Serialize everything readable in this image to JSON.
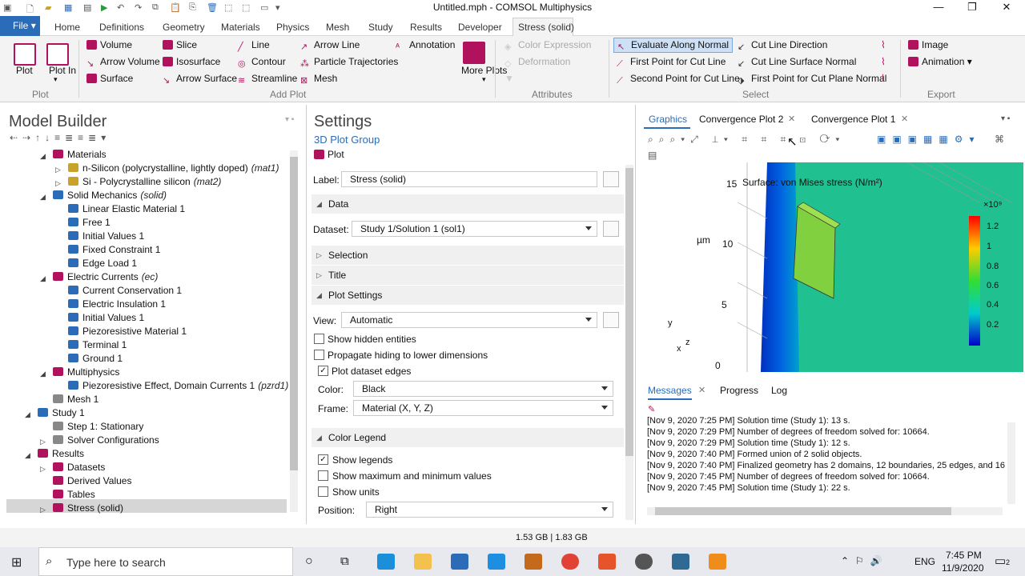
{
  "window": {
    "title": "Untitled.mph - COMSOL Multiphysics",
    "min": "—",
    "max": "❐",
    "close": "✕"
  },
  "menu": {
    "file": "File",
    "tabs": [
      "Home",
      "Definitions",
      "Geometry",
      "Materials",
      "Physics",
      "Mesh",
      "Study",
      "Results",
      "Developer",
      "Stress (solid)"
    ]
  },
  "ribbon": {
    "plot": "Plot",
    "plot_in": "Plot In",
    "plot_in_arrow": "▾",
    "group_plot": "Plot",
    "add": [
      "Volume",
      "Arrow Volume",
      "Surface",
      "Slice",
      "Isosurface",
      "Arrow Surface",
      "Line",
      "Contour",
      "Streamline",
      "Arrow Line",
      "Particle Trajectories",
      "Mesh",
      "Annotation"
    ],
    "more_plots": "More Plots",
    "more_plots_arrow": "▾",
    "group_addplot": "Add Plot",
    "attributes": [
      "Color Expression",
      "Deformation"
    ],
    "group_attributes": "Attributes",
    "select": [
      "Evaluate Along Normal",
      "First Point for Cut Line",
      "Second Point for Cut Line",
      "Cut Line Direction",
      "Cut Line Surface Normal",
      "First Point for Cut Plane Normal"
    ],
    "group_select": "Select",
    "export": [
      "Image",
      "Animation"
    ],
    "export_arrow": "▾",
    "group_export": "Export"
  },
  "model_builder": {
    "title": "Model Builder",
    "items": [
      {
        "t": "Materials",
        "s": ""
      },
      {
        "t": "n-Silicon (polycrystalline, lightly doped)",
        "s": "(mat1)"
      },
      {
        "t": "Si - Polycrystalline silicon",
        "s": "(mat2)"
      },
      {
        "t": "Solid Mechanics",
        "s": "(solid)"
      },
      {
        "t": "Linear Elastic Material 1",
        "s": ""
      },
      {
        "t": "Free 1",
        "s": ""
      },
      {
        "t": "Initial Values 1",
        "s": ""
      },
      {
        "t": "Fixed Constraint 1",
        "s": ""
      },
      {
        "t": "Edge Load 1",
        "s": ""
      },
      {
        "t": "Electric Currents",
        "s": "(ec)"
      },
      {
        "t": "Current Conservation 1",
        "s": ""
      },
      {
        "t": "Electric Insulation 1",
        "s": ""
      },
      {
        "t": "Initial Values 1",
        "s": ""
      },
      {
        "t": "Piezoresistive Material 1",
        "s": ""
      },
      {
        "t": "Terminal 1",
        "s": ""
      },
      {
        "t": "Ground 1",
        "s": ""
      },
      {
        "t": "Multiphysics",
        "s": ""
      },
      {
        "t": "Piezoresistive Effect, Domain Currents 1",
        "s": "(pzrd1)"
      },
      {
        "t": "Mesh 1",
        "s": ""
      },
      {
        "t": "Study 1",
        "s": ""
      },
      {
        "t": "Step 1: Stationary",
        "s": ""
      },
      {
        "t": "Solver Configurations",
        "s": ""
      },
      {
        "t": "Results",
        "s": ""
      },
      {
        "t": "Datasets",
        "s": ""
      },
      {
        "t": "Derived Values",
        "s": ""
      },
      {
        "t": "Tables",
        "s": ""
      },
      {
        "t": "Stress (solid)",
        "s": ""
      }
    ]
  },
  "settings": {
    "title": "Settings",
    "subtitle": "3D Plot Group",
    "plot_btn": "Plot",
    "label_caption": "Label:",
    "label_value": "Stress (solid)",
    "sec_data": "Data",
    "dataset_caption": "Dataset:",
    "dataset_value": "Study 1/Solution 1 (sol1)",
    "sec_selection": "Selection",
    "sec_title": "Title",
    "sec_plot_settings": "Plot Settings",
    "view_caption": "View:",
    "view_value": "Automatic",
    "show_hidden": "Show hidden entities",
    "propagate": "Propagate hiding to lower dimensions",
    "plot_edges": "Plot dataset edges",
    "color_caption": "Color:",
    "color_value": "Black",
    "frame_caption": "Frame:",
    "frame_value": "Material  (X, Y, Z)",
    "sec_color_legend": "Color Legend",
    "show_legends": "Show legends",
    "show_minmax": "Show maximum and minimum values",
    "show_units": "Show units",
    "position_caption": "Position:",
    "position_value": "Right",
    "check": "✓"
  },
  "graphics": {
    "tabs": [
      "Graphics",
      "Convergence Plot 2",
      "Convergence Plot 1"
    ],
    "plot_title": "Surface: von Mises stress (N/m²)",
    "axis_ticks": [
      "15",
      "10",
      "5",
      "0"
    ],
    "axis_unit": "µm",
    "legend_scale": "×10⁹",
    "legend_ticks": [
      "1.2",
      "1",
      "0.8",
      "0.6",
      "0.4",
      "0.2"
    ],
    "triad": {
      "y": "y",
      "z": "z",
      "x": "x"
    }
  },
  "messages": {
    "tabs": [
      "Messages",
      "Progress",
      "Log"
    ],
    "lines": [
      "[Nov 9, 2020 7:25 PM] Solution time (Study 1): 13 s.",
      "[Nov 9, 2020 7:29 PM] Number of degrees of freedom solved for: 10664.",
      "[Nov 9, 2020 7:29 PM] Solution time (Study 1): 12 s.",
      "[Nov 9, 2020 7:40 PM] Formed union of 2 solid objects.",
      "[Nov 9, 2020 7:40 PM] Finalized geometry has 2 domains, 12 boundaries, 25 edges, and 16 v",
      "[Nov 9, 2020 7:45 PM] Number of degrees of freedom solved for: 10664.",
      "[Nov 9, 2020 7:45 PM] Solution time (Study 1): 22 s."
    ]
  },
  "status": {
    "memory": "1.53 GB | 1.83 GB"
  },
  "taskbar": {
    "search_placeholder": "Type here to search",
    "lang": "ENG",
    "time": "7:45 PM",
    "date": "11/9/2020",
    "notif": "2"
  },
  "colors": {
    "accent": "#2b6cb8",
    "plot_ink": "#b0125e",
    "legend": [
      "#ff0000",
      "#ffcc00",
      "#33dd33",
      "#00cccc",
      "#0000cc"
    ]
  }
}
